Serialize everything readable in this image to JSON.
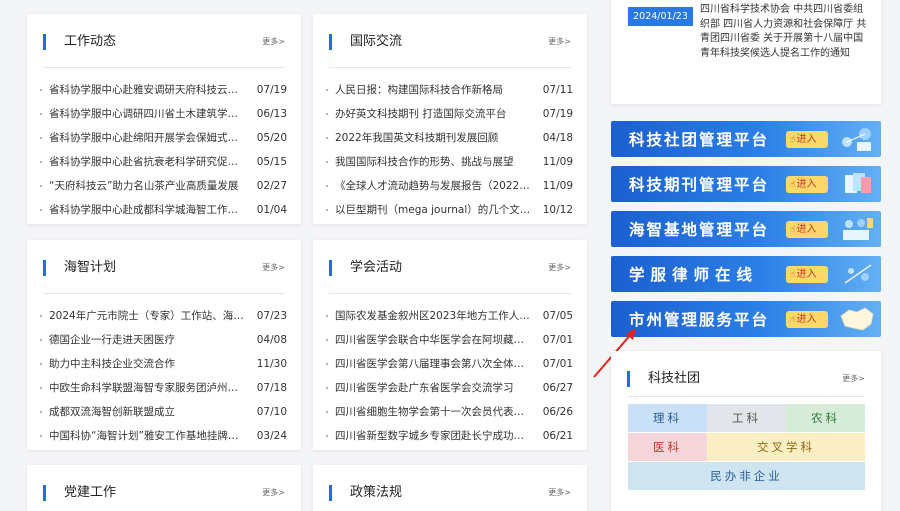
{
  "panels": {
    "gongzuo": {
      "title": "工作动态",
      "more": "更多>",
      "items": [
        {
          "text": "省科协学服中心赴雅安调研天府科技云…",
          "date": "07/19"
        },
        {
          "text": "省科协学服中心调研四川省土木建筑学…",
          "date": "06/13"
        },
        {
          "text": "省科协学服中心赴绵阳开展学会保姆式…",
          "date": "05/20"
        },
        {
          "text": "省科协学服中心赴省抗衰老科学研究促…",
          "date": "05/15"
        },
        {
          "text": "“天府科技云”助力名山茶产业高质量发展",
          "date": "02/27"
        },
        {
          "text": "省科协学服中心赴成都科学城海智工作…",
          "date": "01/04"
        }
      ]
    },
    "guoji": {
      "title": "国际交流",
      "more": "更多>",
      "items": [
        {
          "text": "人民日报：构建国际科技合作新格局",
          "date": "07/11"
        },
        {
          "text": "办好英文科技期刊 打造国际交流平台",
          "date": "07/19"
        },
        {
          "text": "2022年我国英文科技期刊发展回顾",
          "date": "04/18"
        },
        {
          "text": "我国国际科技合作的形势、挑战与展望",
          "date": "11/09"
        },
        {
          "text": "《全球人才流动趋势与发展报告（2022…",
          "date": "11/09"
        },
        {
          "text": "以巨型期刊（mega journal）的几个文…",
          "date": "10/12"
        }
      ]
    },
    "haizhi": {
      "title": "海智计划",
      "more": "更多>",
      "items": [
        {
          "text": "2024年广元市院士（专家）工作站、海…",
          "date": "07/23"
        },
        {
          "text": "德国企业一行走进天困医疗",
          "date": "04/08"
        },
        {
          "text": "助力中主科技企业交流合作",
          "date": "11/30"
        },
        {
          "text": "中欧生命科学联盟海智专家服务团泸州…",
          "date": "07/18"
        },
        {
          "text": "成都双流海智创新联盟成立",
          "date": "07/10"
        },
        {
          "text": "中国科协“海智计划”雅安工作基地挂牌…",
          "date": "03/24"
        }
      ]
    },
    "xuehui": {
      "title": "学会活动",
      "more": "更多>",
      "items": [
        {
          "text": "国际农发基金叙州区2023年地方工作人…",
          "date": "07/05"
        },
        {
          "text": "四川省医学会联合中华医学会在阿坝藏…",
          "date": "07/01"
        },
        {
          "text": "四川省医学会第八届理事会第八次全体…",
          "date": "07/01"
        },
        {
          "text": "四川省医学会赴广东省医学会交流学习",
          "date": "06/27"
        },
        {
          "text": "四川省细胞生物学会第十一次会员代表…",
          "date": "06/26"
        },
        {
          "text": "四川省新型数字城乡专家团赴长宁成功…",
          "date": "06/21"
        }
      ]
    },
    "dangjian": {
      "title": "党建工作",
      "more": "更多>"
    },
    "zhengce": {
      "title": "政策法规",
      "more": "更多>"
    }
  },
  "notice": {
    "date": "2024/01/23",
    "text": "四川省科学技术协会 中共四川省委组织部 四川省人力资源和社会保障厅 共青团四川省委 关于开展第十八届中国青年科技奖候选人提名工作的通知"
  },
  "platforms": [
    {
      "label": "科技社团管理平台",
      "enter": "进入"
    },
    {
      "label": "科技期刊管理平台",
      "enter": "进入"
    },
    {
      "label": "海智基地管理平台",
      "enter": "进入"
    },
    {
      "label": "学服律师在线",
      "enter": "进入"
    },
    {
      "label": "市州管理服务平台",
      "enter": "进入"
    }
  ],
  "keji_shetuan": {
    "title": "科技社团",
    "more": "更多>",
    "tags": [
      "理科",
      "工科",
      "农科",
      "医科",
      "交叉学科",
      "民办非企业"
    ]
  },
  "colors": {
    "accent": "#1e6fd9",
    "banner_start": "#1b5fd0",
    "tag_like": "#c9e0f6",
    "tag_gongke": "#e2e5e9",
    "tag_nongke": "#d6ecd9",
    "tag_yike": "#f6d6da",
    "tag_jiaocha": "#fbeec3",
    "tag_minban": "#cfe4f1"
  }
}
